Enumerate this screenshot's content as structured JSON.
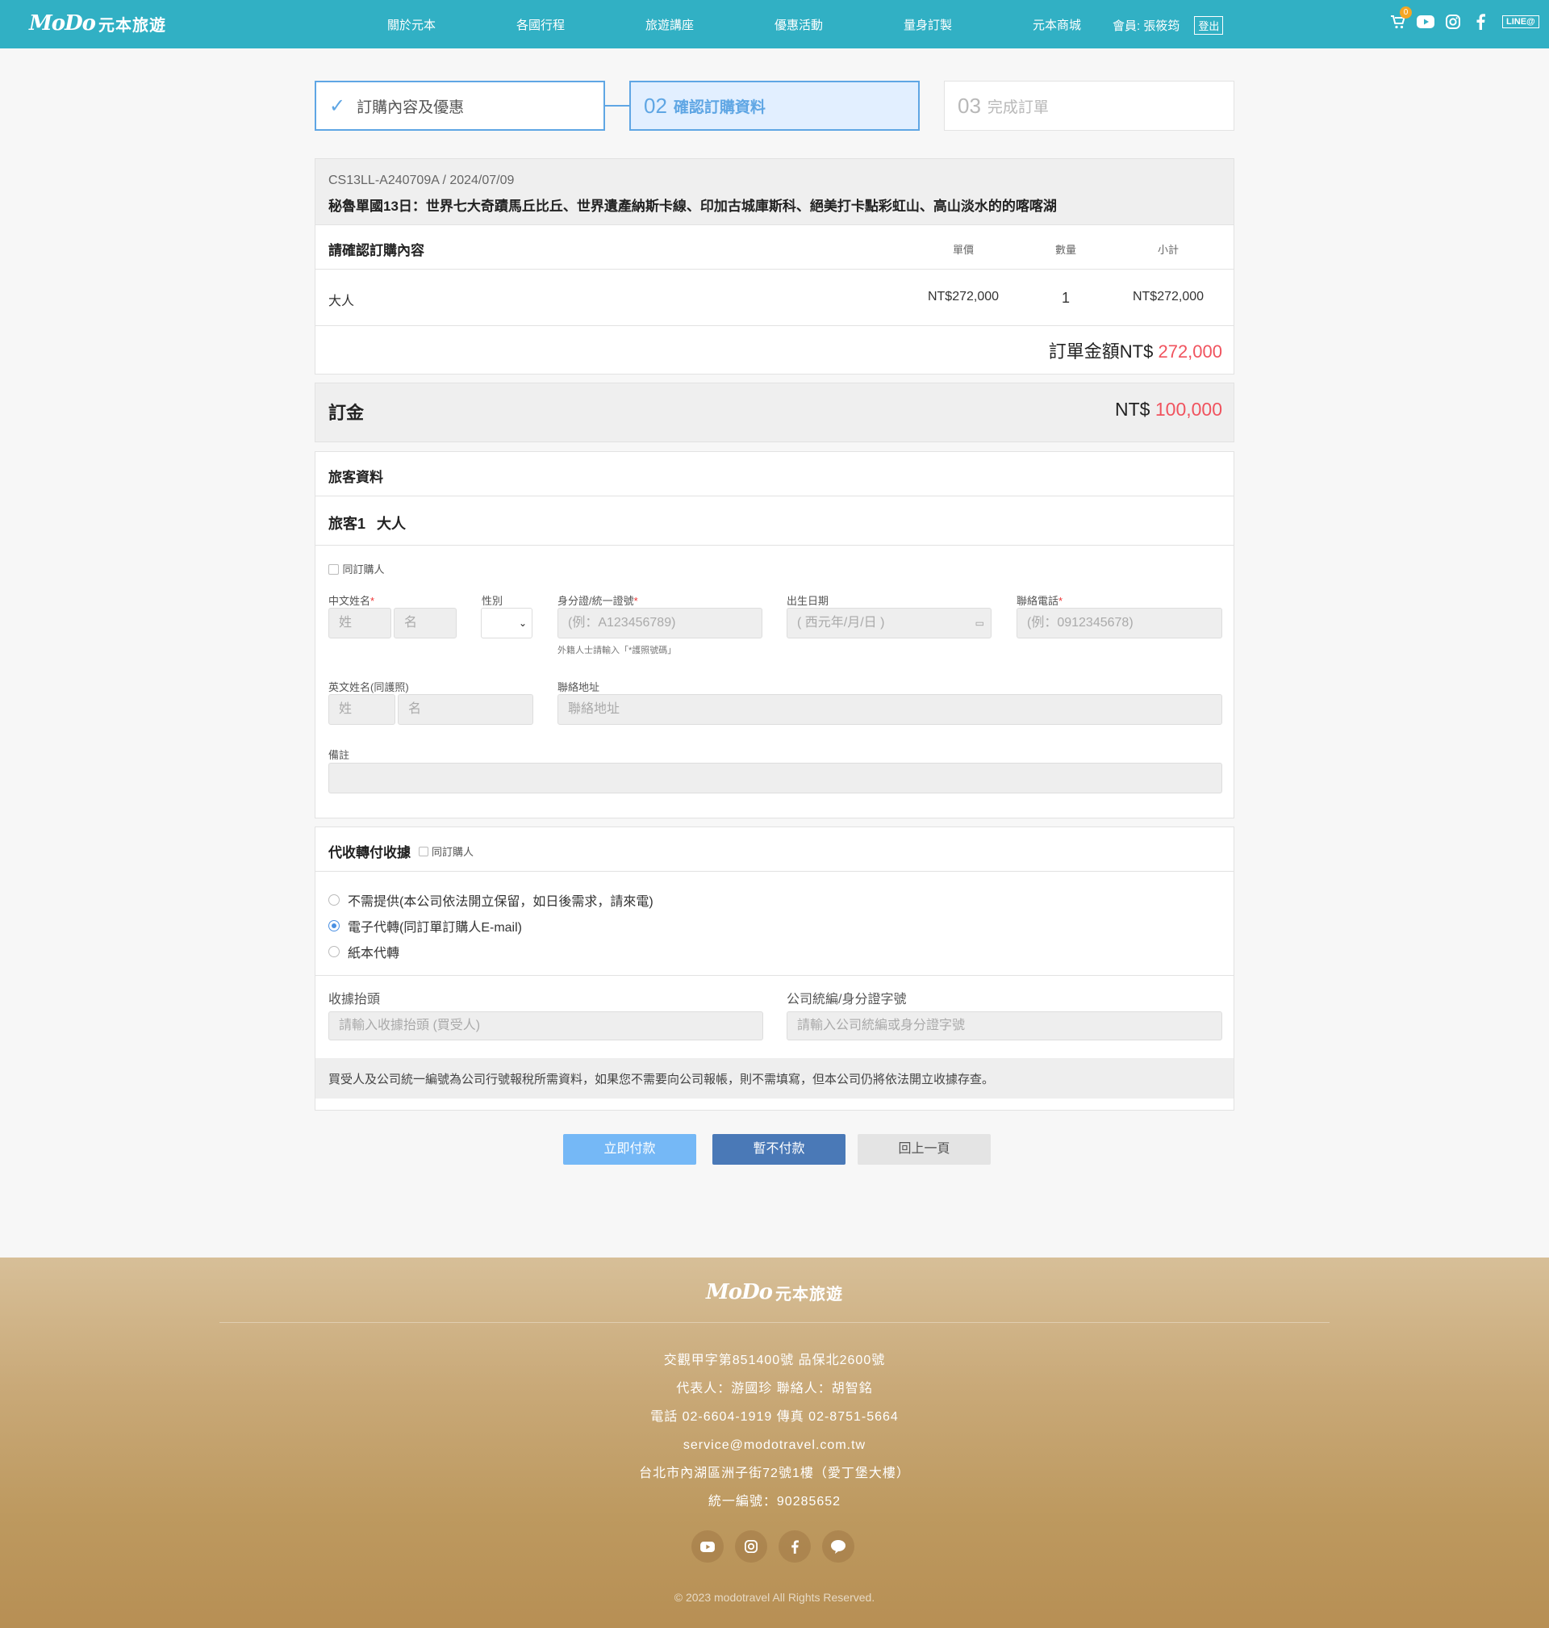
{
  "brand": {
    "logo_mark": "MoDo",
    "logo_name": "元本旅遊"
  },
  "nav": {
    "items": [
      "關於元本",
      "各國行程",
      "旅遊講座",
      "優惠活動",
      "量身訂製",
      "元本商城"
    ],
    "member_label": "會員: 張筱筠",
    "logout_label": "登出",
    "cart_count": "0",
    "line_label": "LINE@"
  },
  "steps": [
    {
      "num": "",
      "label": "訂購內容及優惠"
    },
    {
      "num": "02",
      "label": "確認訂購資料"
    },
    {
      "num": "03",
      "label": "完成訂單"
    }
  ],
  "order": {
    "code": "CS13LL-A240709A / 2024/07/09",
    "title": "秘魯單國13日：世界七大奇蹟馬丘比丘、世界遺產納斯卡線、印加古城庫斯科、絕美打卡點彩虹山、高山淡水的的喀喀湖",
    "confirm_label": "請確認訂購內容",
    "col_price": "單價",
    "col_qty": "數量",
    "col_subtotal": "小計",
    "rows": [
      {
        "name": "大人",
        "price": "NT$272,000",
        "qty": "1",
        "subtotal": "NT$272,000"
      }
    ],
    "total_label": "訂單金額NT$",
    "total_value": "272,000"
  },
  "deposit": {
    "label": "訂金",
    "currency": "NT$",
    "value": "100,000"
  },
  "traveler": {
    "section_title": "旅客資料",
    "traveler_label": "旅客1",
    "traveler_type": "大人",
    "same_as_buyer": "同訂購人",
    "cn_name_label": "中文姓名",
    "cn_last_ph": "姓",
    "cn_first_ph": "名",
    "gender_label": "性別",
    "id_label": "身分證/統一證號",
    "id_ph": "(例：A123456789)",
    "id_hint": "外籍人士請輸入「*護照號碼」",
    "birth_label": "出生日期",
    "birth_ph": "( 西元年/月/日 )",
    "phone_label": "聯絡電話",
    "phone_ph": "(例：0912345678)",
    "en_name_label": "英文姓名(同護照)",
    "en_last_ph": "姓",
    "en_first_ph": "名",
    "address_label": "聯絡地址",
    "address_ph": "聯絡地址",
    "remark_label": "備註",
    "required_mark": "*"
  },
  "receipt": {
    "section_title": "代收轉付收據",
    "same_as_buyer": "同訂購人",
    "options": [
      {
        "label": "不需提供(本公司依法開立保留，如日後需求，請來電)",
        "selected": false
      },
      {
        "label": "電子代轉(同訂單訂購人E-mail)",
        "selected": true
      },
      {
        "label": "紙本代轉",
        "selected": false
      }
    ],
    "title_label": "收據抬頭",
    "title_ph": "請輸入收據抬頭 (買受人)",
    "tax_label": "公司統編/身分證字號",
    "tax_ph": "請輸入公司統編或身分證字號",
    "note": "買受人及公司統一編號為公司行號報稅所需資料，如果您不需要向公司報帳，則不需填寫，但本公司仍將依法開立收據存查。"
  },
  "actions": {
    "pay_now": "立即付款",
    "pay_later": "暫不付款",
    "back": "回上一頁"
  },
  "footer": {
    "lines": [
      "交觀甲字第851400號 品保北2600號",
      "代表人：游國珍 聯絡人：胡智銘",
      "電話 02-6604-1919 傳真 02-8751-5664",
      "service@modotravel.com.tw",
      "台北市內湖區洲子街72號1樓（愛丁堡大樓）",
      "統一編號：90285652"
    ],
    "copyright": "© 2023 modotravel All Rights Reserved."
  },
  "colors": {
    "header": "#31b0c4",
    "accent": "#5fa6e4",
    "price": "#f0535e",
    "pay_btn": "#75b8f6",
    "later_btn": "#4a79b7"
  },
  "icons": [
    "cart-icon",
    "youtube-icon",
    "instagram-icon",
    "facebook-icon",
    "check-icon",
    "calendar-icon",
    "line-icon"
  ]
}
